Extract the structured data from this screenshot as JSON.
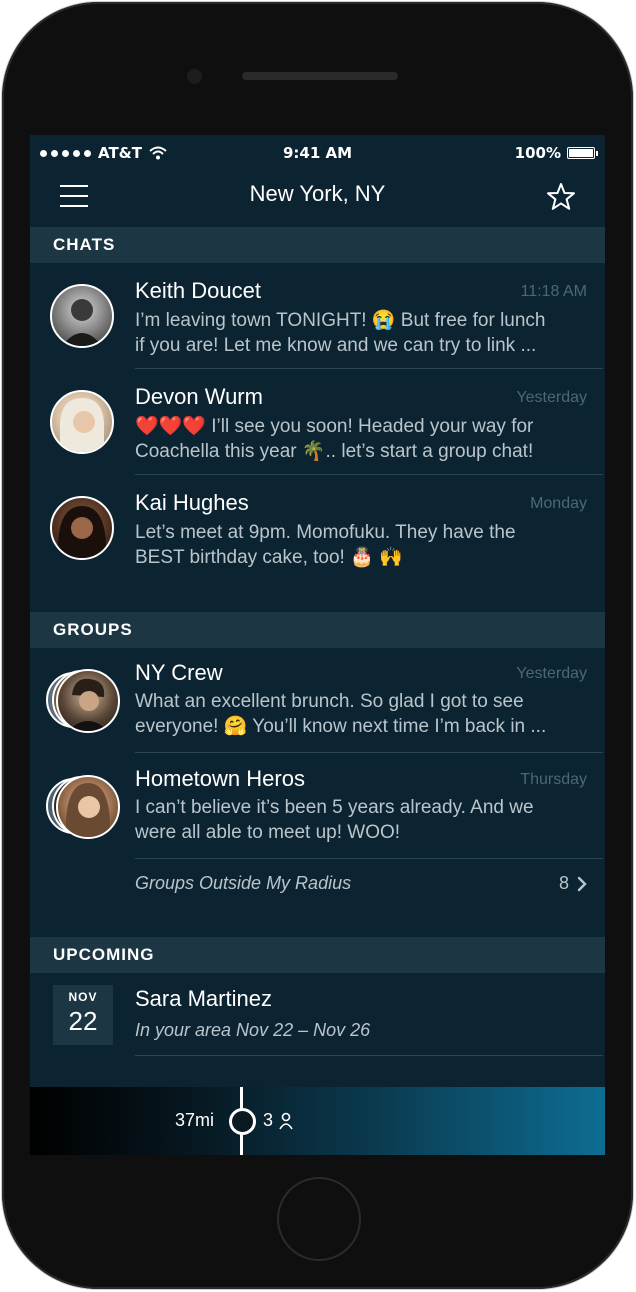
{
  "status_bar": {
    "carrier": "AT&T",
    "time": "9:41 AM",
    "battery": "100%",
    "wifi_icon": "wifi-icon",
    "battery_icon": "battery-icon"
  },
  "navbar": {
    "title": "New York, NY",
    "menu_icon": "hamburger-menu-icon",
    "favorite_icon": "star-icon"
  },
  "chats": {
    "header": "CHATS",
    "items": [
      {
        "name": "Keith Doucet",
        "time": "11:18 AM",
        "line1": "I’m leaving town TONIGHT! 😭 But free for lunch",
        "line2": "if you are! Let me know and we can try to link ..."
      },
      {
        "name": "Devon Wurm",
        "time": "Yesterday",
        "line1": "❤️❤️❤️ I’ll see you soon! Headed your way for",
        "line2": "Coachella this year 🌴.. let’s start a group chat!"
      },
      {
        "name": "Kai Hughes",
        "time": "Monday",
        "line1": "Let’s meet at 9pm. Momofuku. They have the",
        "line2": "BEST birthday cake, too! 🎂 🙌"
      }
    ]
  },
  "groups": {
    "header": "GROUPS",
    "items": [
      {
        "name": "NY Crew",
        "time": "Yesterday",
        "line1": "What an excellent brunch. So glad I got to see",
        "line2": "everyone! 🤗 You’ll know next time I’m back in ..."
      },
      {
        "name": "Hometown Heros",
        "time": "Thursday",
        "line1": "I can’t believe it’s been 5 years already. And we",
        "line2": "were all able to meet up! WOO!"
      }
    ],
    "outside_label": "Groups Outside My Radius",
    "outside_count": "8"
  },
  "upcoming": {
    "header": "UPCOMING",
    "items": [
      {
        "month": "NOV",
        "day": "22",
        "name": "Sara Martinez",
        "subtitle": "In your area Nov 22 – Nov 26"
      }
    ]
  },
  "bottom_bar": {
    "distance": "37mi",
    "people_count": "3",
    "person_icon": "person-icon"
  },
  "colors": {
    "background": "#0c2431",
    "section_header": "#1c3644",
    "accent": "#0d6d93"
  }
}
